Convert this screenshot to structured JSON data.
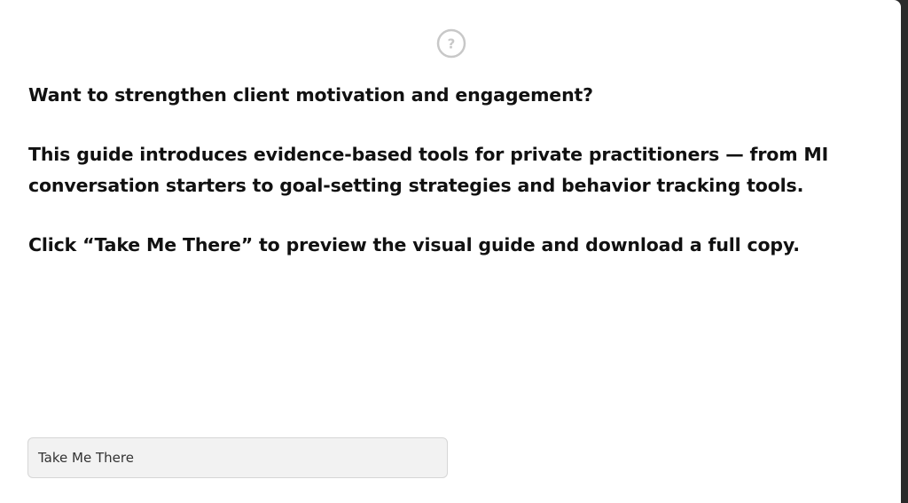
{
  "dialog": {
    "icon": "question-circle-icon",
    "paragraphs": [
      "Want to strengthen client motivation and engagement?",
      "This guide introduces evidence-based tools for private practitioners — from MI conversation starters to goal-setting strategies and behavior tracking tools.",
      "Click “Take Me There” to preview the visual guide and download a full copy."
    ],
    "button_label": "Take Me There"
  },
  "colors": {
    "background": "#ffffff",
    "text": "#111111",
    "button_background": "#f2f2f2",
    "button_border": "#d6d6d6",
    "icon": "#c8c8c8"
  }
}
